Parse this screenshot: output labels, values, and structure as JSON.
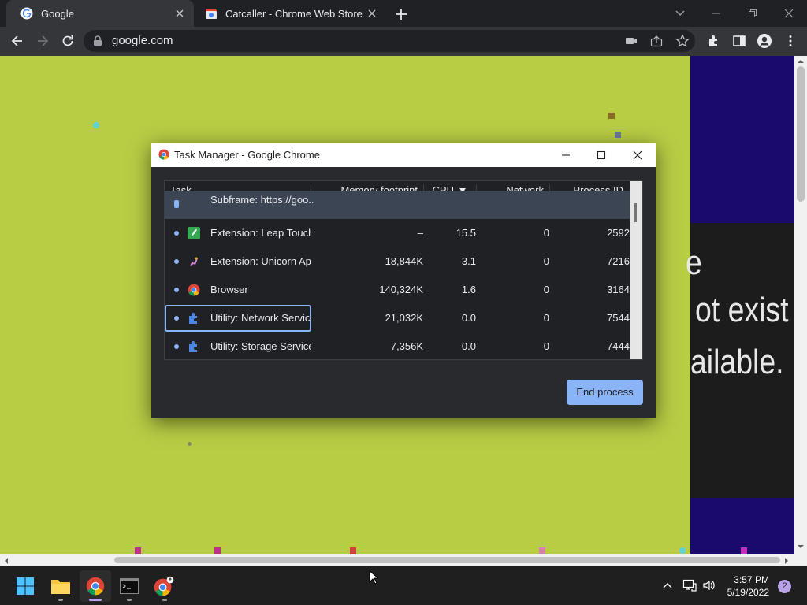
{
  "browser": {
    "tabs": [
      {
        "title": "Google",
        "active": true
      },
      {
        "title": "Catcaller - Chrome Web Store",
        "active": false
      }
    ],
    "url": "google.com"
  },
  "page": {
    "background": "#b8cc44",
    "side_text_lines": [
      "e",
      "ot exist",
      "ailable."
    ]
  },
  "task_manager": {
    "title": "Task Manager - Google Chrome",
    "columns": {
      "task": "Task",
      "memory": "Memory footprint",
      "cpu": "CPU",
      "network": "Network",
      "pid": "Process ID"
    },
    "rows": [
      {
        "task": "Subframe: https://goo...",
        "memory": "",
        "cpu": "",
        "network": "",
        "pid": "",
        "icon": "subframe-icon",
        "selected": true
      },
      {
        "task": "Extension: Leap Touch",
        "memory": "–",
        "cpu": "15.5",
        "network": "0",
        "pid": "2592",
        "icon": "leap-touch-extension-icon"
      },
      {
        "task": "Extension: Unicorn Ap...",
        "memory": "18,844K",
        "cpu": "3.1",
        "network": "0",
        "pid": "7216",
        "icon": "unicorn-extension-icon"
      },
      {
        "task": "Browser",
        "memory": "140,324K",
        "cpu": "1.6",
        "network": "0",
        "pid": "3164",
        "icon": "chrome-icon"
      },
      {
        "task": "Utility: Network Service",
        "memory": "21,032K",
        "cpu": "0.0",
        "network": "0",
        "pid": "7544",
        "icon": "puzzle-icon",
        "focused": true
      },
      {
        "task": "Utility: Storage Service",
        "memory": "7,356K",
        "cpu": "0.0",
        "network": "0",
        "pid": "7444",
        "icon": "puzzle-icon"
      }
    ],
    "end_process_label": "End process"
  },
  "taskbar": {
    "time": "3:57 PM",
    "date": "5/19/2022",
    "notification_count": "2"
  },
  "colors": {
    "accent": "#8ab4f8",
    "chrome_dark": "#202124"
  }
}
